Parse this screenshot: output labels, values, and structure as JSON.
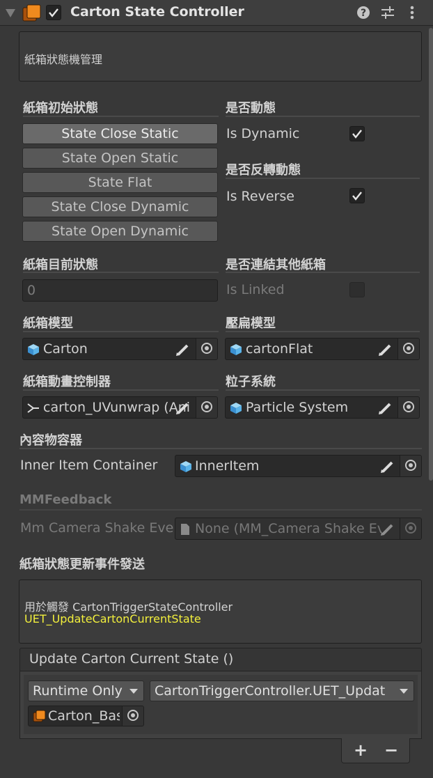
{
  "header": {
    "title": "Carton State Controller",
    "enabled": true,
    "icons": [
      "collapse-triangle-icon",
      "script-component-icon",
      "help-icon",
      "presets-icon",
      "kebab-menu-icon"
    ]
  },
  "description": "紙箱狀態機管理",
  "initial_state": {
    "title": "紙箱初始狀態",
    "buttons": [
      "State Close Static",
      "State Open Static",
      "State Flat",
      "State Close Dynamic",
      "State Open Dynamic"
    ],
    "selected": "State Close Static"
  },
  "dynamic": {
    "title": "是否動態",
    "label": "Is Dynamic",
    "checked": true
  },
  "reverse": {
    "title": "是否反轉動態",
    "label": "Is Reverse",
    "checked": true
  },
  "current_state": {
    "title": "紙箱目前狀態",
    "value": "0"
  },
  "linked": {
    "title": "是否連結其他紙箱",
    "label": "Is Linked",
    "checked": false
  },
  "carton_model": {
    "title": "紙箱模型",
    "value": "Carton"
  },
  "flat_model": {
    "title": "壓扁模型",
    "value": "cartonFlat"
  },
  "anim_controller": {
    "title": "紙箱動畫控制器",
    "value": "carton_UVunwrap (Ani"
  },
  "particles": {
    "title": "粒子系統",
    "value": "Particle System"
  },
  "container": {
    "title": "內容物容器",
    "label": "Inner Item Container",
    "value": "InnerItem"
  },
  "feedback": {
    "title": "MMFeedback",
    "label": "Mm Camera Shake Eve",
    "value": "None (MM_Camera Shake Eve"
  },
  "event_section": {
    "title": "紙箱狀態更新事件發送",
    "help_line1": "用於觸發 CartonTriggerStateController",
    "help_line2": "UET_UpdateCartonCurrentState",
    "highlight_color": "#f2ef3c"
  },
  "unity_event": {
    "header": "Update Carton Current State ()",
    "runtime": "Runtime Only",
    "function": "CartonTriggerController.UET_Updat",
    "target": "Carton_Bas",
    "add_label": "+",
    "remove_label": "−"
  },
  "colors": {
    "background": "#383838",
    "field": "#2a2a2a",
    "button": "#585858",
    "script_icon": "#e9821c"
  }
}
